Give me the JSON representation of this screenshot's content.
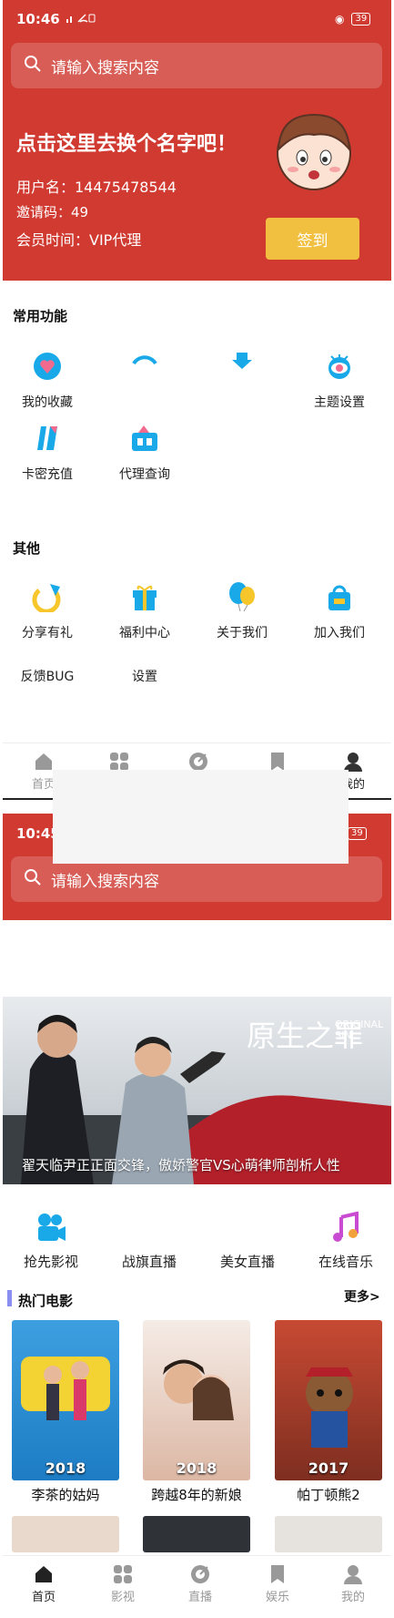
{
  "status1": {
    "time": "10:46",
    "signal_icons": "wifi-signal",
    "battery": "39"
  },
  "search": {
    "placeholder": "请输入搜索内容"
  },
  "profile": {
    "nickname_prompt": "点击这里去换个名字吧！",
    "username": "用户名：14475478544",
    "invite_code": "邀请码：49",
    "membership": "会员时间：VIP代理",
    "signin_label": "签到"
  },
  "common": {
    "title": "常用功能",
    "items": [
      {
        "label": "我的收藏",
        "icon": "heart-drop-icon"
      },
      {
        "label": "",
        "icon": "arc-icon"
      },
      {
        "label": "",
        "icon": "pin-icon"
      },
      {
        "label": "主题设置",
        "icon": "eye-icon"
      },
      {
        "label": "卡密充值",
        "icon": "card-icon"
      },
      {
        "label": "代理查询",
        "icon": "ticket-icon"
      }
    ]
  },
  "other": {
    "title": "其他",
    "items": [
      {
        "label": "分享有礼",
        "icon": "share-icon"
      },
      {
        "label": "福利中心",
        "icon": "gift-icon"
      },
      {
        "label": "关于我们",
        "icon": "balloon-icon"
      },
      {
        "label": "加入我们",
        "icon": "bag-icon"
      },
      {
        "label": "反馈BUG",
        "icon": ""
      },
      {
        "label": "设置",
        "icon": ""
      }
    ]
  },
  "tabbar1": {
    "items": [
      "首页",
      "",
      "",
      "",
      "我的"
    ]
  },
  "status2": {
    "time": "10:45",
    "battery": "39"
  },
  "banner": {
    "title_text": "原生之罪",
    "subtitle_text": "ORIGINAL SIN",
    "caption": "翟天临尹正正面交锋，傲娇警官VS心萌律师剖析人性"
  },
  "quick": {
    "items": [
      "抢先影视",
      "战旗直播",
      "美女直播",
      "在线音乐"
    ]
  },
  "hot": {
    "title": "热门电影",
    "more": "更多>",
    "movies": [
      {
        "title": "李茶的姑妈",
        "year": "2018",
        "color": "#2a8fd6"
      },
      {
        "title": "跨越8年的新娘",
        "year": "2018",
        "color": "#e7c9b8"
      },
      {
        "title": "帕丁顿熊2",
        "year": "2017",
        "color": "#b4442f"
      }
    ]
  },
  "tabbar2": {
    "items": [
      "首页",
      "影视",
      "直播",
      "娱乐",
      "我的"
    ]
  },
  "colors": {
    "brand_red": "#d03a31",
    "signin_yellow": "#f2c040",
    "icon_blue": "#19a9e9",
    "accent_purple": "#8a8ef0"
  }
}
